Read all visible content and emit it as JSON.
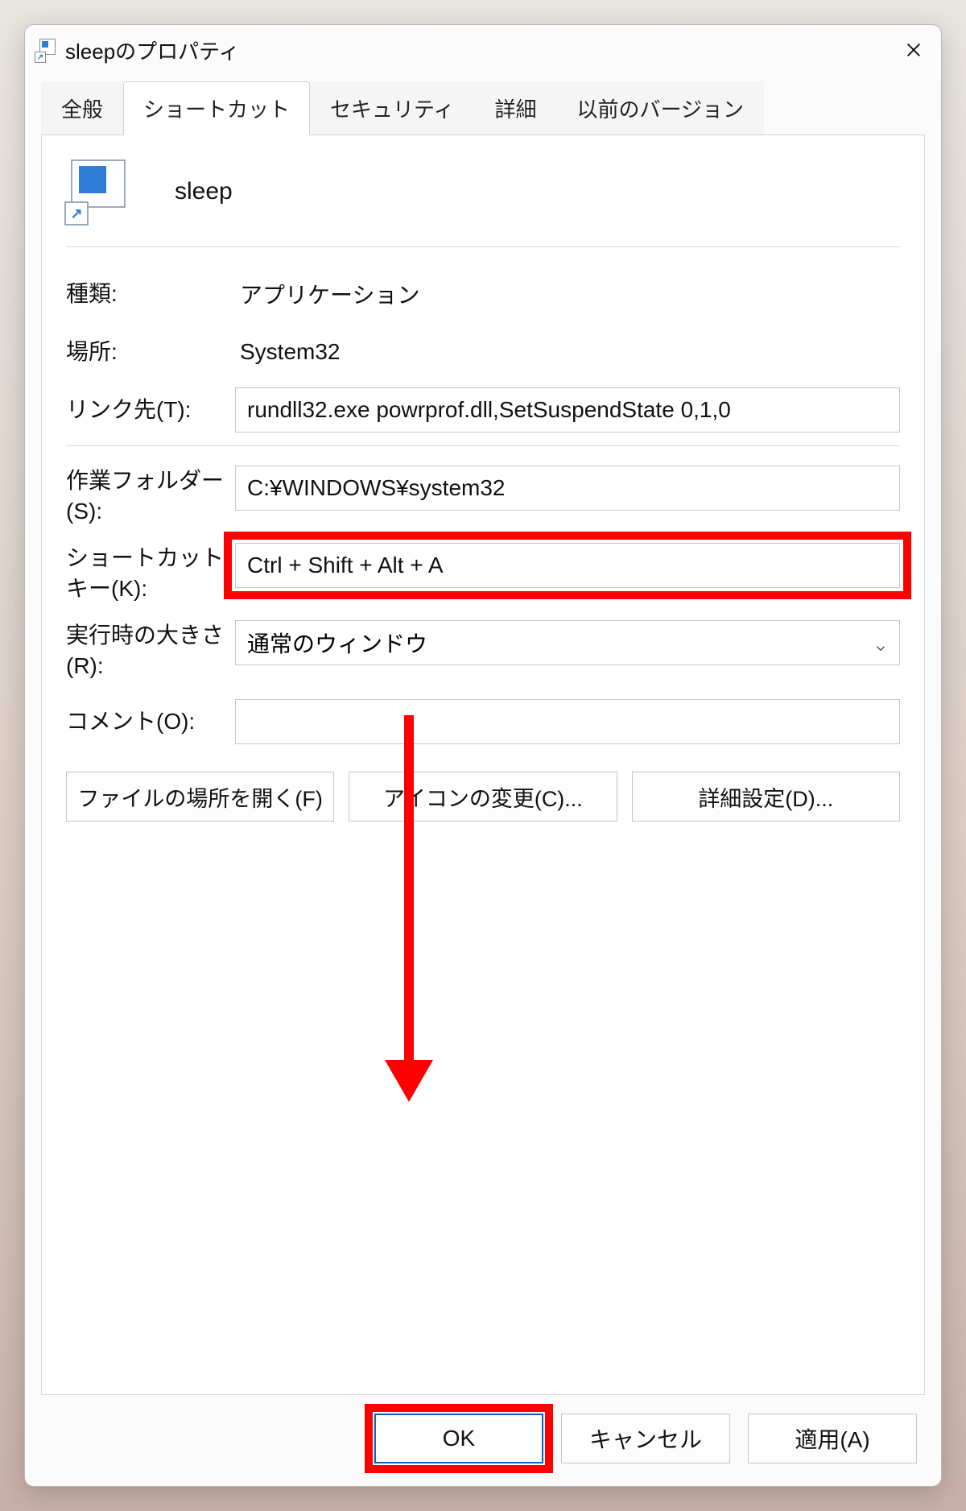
{
  "title": "sleepのプロパティ",
  "tabs": {
    "general": "全般",
    "shortcut": "ショートカット",
    "security": "セキュリティ",
    "details": "詳細",
    "previous": "以前のバージョン"
  },
  "shortcut_name": "sleep",
  "fields": {
    "type_label": "種類:",
    "type_value": "アプリケーション",
    "location_label": "場所:",
    "location_value": "System32",
    "target_label": "リンク先(T):",
    "target_value": "rundll32.exe powrprof.dll,SetSuspendState 0,1,0",
    "startin_label": "作業フォルダー(S):",
    "startin_value": "C:¥WINDOWS¥system32",
    "hotkey_label": "ショートカット キー(K):",
    "hotkey_value": "Ctrl + Shift + Alt + A",
    "run_label": "実行時の大きさ(R):",
    "run_value": "通常のウィンドウ",
    "comment_label": "コメント(O):",
    "comment_value": ""
  },
  "actions": {
    "open_location": "ファイルの場所を開く(F)",
    "change_icon": "アイコンの変更(C)...",
    "advanced": "詳細設定(D)..."
  },
  "footer": {
    "ok": "OK",
    "cancel": "キャンセル",
    "apply": "適用(A)"
  }
}
